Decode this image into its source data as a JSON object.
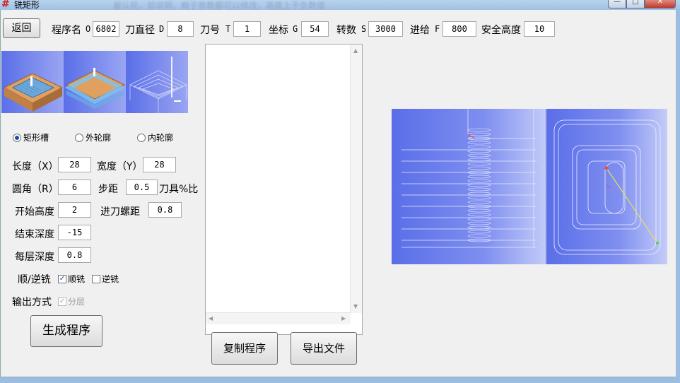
{
  "window": {
    "app_icon": "#",
    "title": "铣矩形",
    "blurred_caption": "最认民，却说明，概于参数都可以修改，高度上于负数值",
    "controls": {
      "minimize": "—",
      "maximize": "□",
      "close": "✕"
    }
  },
  "toolbar": {
    "back_label": "返回",
    "program_name": {
      "label": "程序名",
      "prefix": "O",
      "value": "6802"
    },
    "tool_diameter": {
      "label": "刀直径",
      "prefix": "D",
      "value": "8"
    },
    "tool_number": {
      "label": "刀号",
      "prefix": "T",
      "value": "1"
    },
    "coordinate": {
      "label": "坐标",
      "prefix": "G",
      "value": "54"
    },
    "spindle_speed": {
      "label": "转数",
      "prefix": "S",
      "value": "3000"
    },
    "feed": {
      "label": "进给",
      "prefix": "F",
      "value": "800"
    },
    "safe_height": {
      "label": "安全高度",
      "value": "10"
    }
  },
  "mode": {
    "options": [
      "矩形槽",
      "外轮廓",
      "内轮廓"
    ],
    "selected": "矩形槽"
  },
  "params": {
    "length": {
      "label": "长度（X）",
      "value": "28"
    },
    "width": {
      "label": "宽度（Y）",
      "value": "28"
    },
    "corner": {
      "label": "圆角（R）",
      "value": "6"
    },
    "step": {
      "label": "步距",
      "value": "0.5",
      "suffix": "刀具%比"
    },
    "start_height": {
      "label": "开始高度",
      "value": "2"
    },
    "feed_pitch": {
      "label": "进刀螺距",
      "value": "0.8"
    },
    "end_depth": {
      "label": "结束深度",
      "value": "-15"
    },
    "layer_depth": {
      "label": "每层深度",
      "value": "0.8"
    }
  },
  "milling": {
    "label": "顺/逆铣",
    "climb": {
      "label": "顺铣",
      "checked": true
    },
    "conventional": {
      "label": "逆铣",
      "checked": false
    }
  },
  "output": {
    "label": "输出方式",
    "layered": {
      "label": "分层",
      "checked": true,
      "disabled": true
    }
  },
  "actions": {
    "generate": "生成程序",
    "copy": "复制程序",
    "export": "导出文件"
  },
  "colors": {
    "preview_bg": "#5a6ee8",
    "preview_bg_light": "#c4ccf8",
    "accent": "#1a4fa0"
  }
}
